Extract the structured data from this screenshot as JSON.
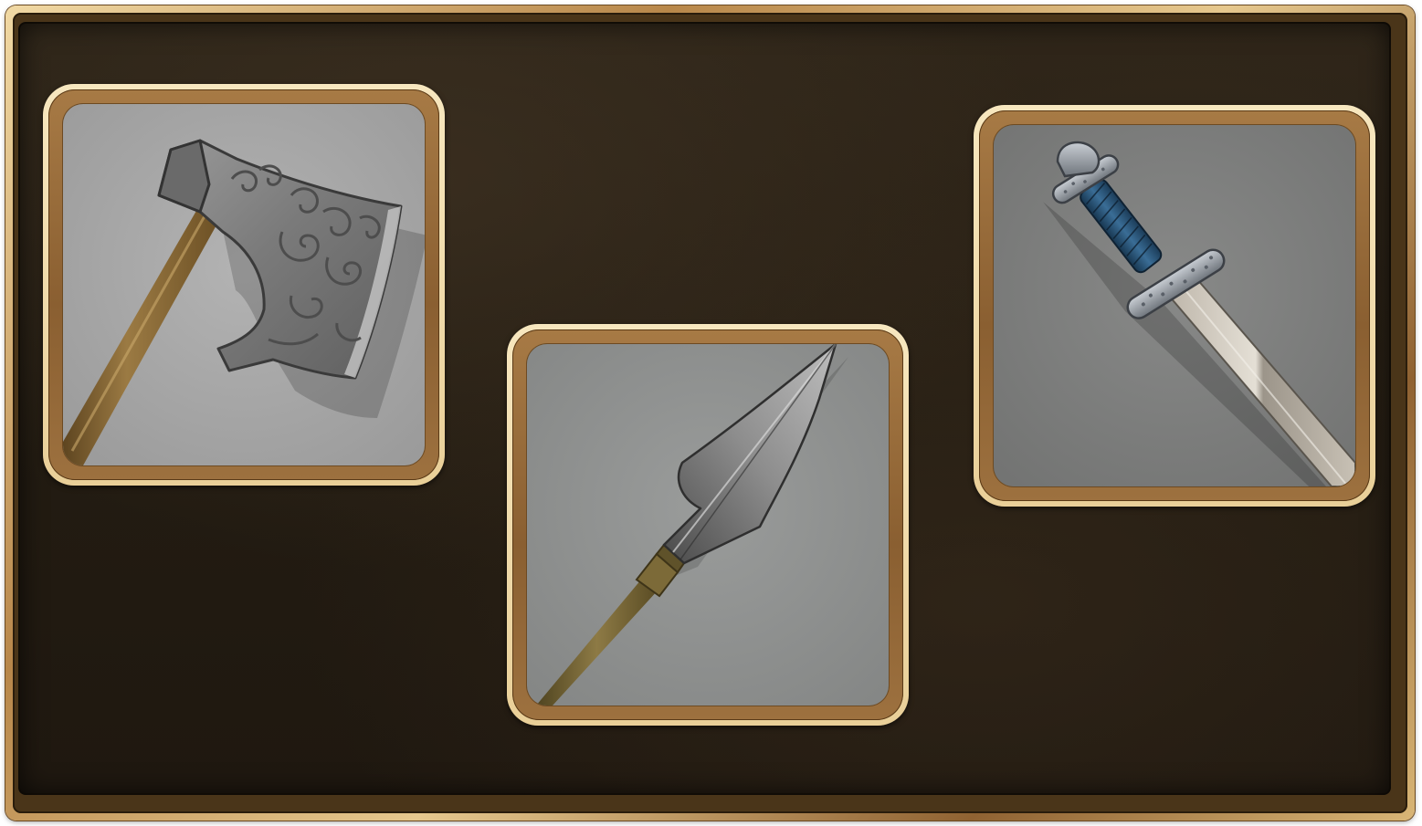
{
  "weapons": [
    {
      "id": "axe",
      "icon": "bearded-axe-icon"
    },
    {
      "id": "spear",
      "icon": "spear-icon"
    },
    {
      "id": "sword",
      "icon": "viking-sword-icon"
    }
  ],
  "colors": {
    "board": "#231c12",
    "frame_gold": "#d9b676",
    "card_rim": "#f3e0b2",
    "card_ring": "#9a6d3a",
    "well_axe": "#a9a9a9",
    "well_spear": "#8f9190",
    "well_sword": "#7e7f7e",
    "steel": "#8c8c8c",
    "wood_shaft": "#8a6a36",
    "grip_blue": "#2d5a82"
  }
}
